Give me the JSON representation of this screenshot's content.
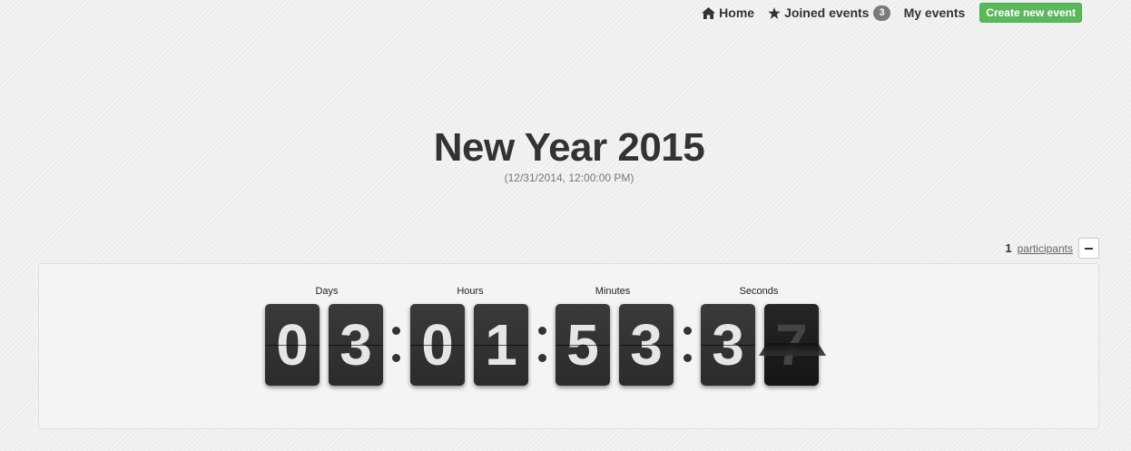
{
  "nav": {
    "home_label": "Home",
    "home_icon": "home-icon",
    "joined_label": "Joined events",
    "joined_icon": "star-icon",
    "joined_count": "3",
    "my_events_label": "My events",
    "create_label": "Create new event",
    "create_color": "#5cb85c"
  },
  "event": {
    "title": "New Year 2015",
    "date": "(12/31/2014, 12:00:00 PM)"
  },
  "participants": {
    "count": "1",
    "link_label": "participants",
    "collapse_icon": "minus-icon"
  },
  "countdown": {
    "days_label": "Days",
    "hours_label": "Hours",
    "minutes_label": "Minutes",
    "seconds_label": "Seconds",
    "days": [
      "0",
      "3"
    ],
    "hours": [
      "0",
      "1"
    ],
    "minutes": [
      "5",
      "3"
    ],
    "seconds": [
      "3",
      "7"
    ]
  }
}
